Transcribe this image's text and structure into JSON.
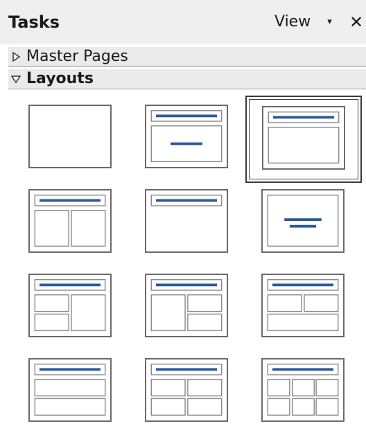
{
  "header": {
    "title": "Tasks",
    "view_label": "View",
    "view_caret": "▾",
    "close_glyph": "✕"
  },
  "sections": {
    "master_pages": {
      "label": "Master Pages",
      "expanded": false
    },
    "layouts": {
      "label": "Layouts",
      "expanded": true
    }
  },
  "colors": {
    "title_bar": "#2a5a9a",
    "frame": "#6a6a6a",
    "selected_border": "#3a3a3a"
  },
  "layouts": [
    {
      "id": "blank",
      "kind": "blank",
      "selected": false
    },
    {
      "id": "title-slide",
      "kind": "title-subtitle",
      "selected": false
    },
    {
      "id": "title-content",
      "kind": "title-content",
      "selected": true
    },
    {
      "id": "title-2-content",
      "kind": "title-two-content",
      "selected": false
    },
    {
      "id": "title-only",
      "kind": "title-only",
      "selected": false
    },
    {
      "id": "centered-text",
      "kind": "centered-text",
      "selected": false
    },
    {
      "id": "title-2-content-content",
      "kind": "two-content-and-content",
      "selected": false
    },
    {
      "id": "title-content-2-content",
      "kind": "content-and-two-content",
      "selected": false
    },
    {
      "id": "title-2-content-over-content",
      "kind": "two-content-over-content",
      "selected": false
    },
    {
      "id": "title-content-over-content",
      "kind": "content-over-content",
      "selected": false
    },
    {
      "id": "title-4-content",
      "kind": "four-content",
      "selected": false
    },
    {
      "id": "title-6-content",
      "kind": "six-content",
      "selected": false
    }
  ]
}
